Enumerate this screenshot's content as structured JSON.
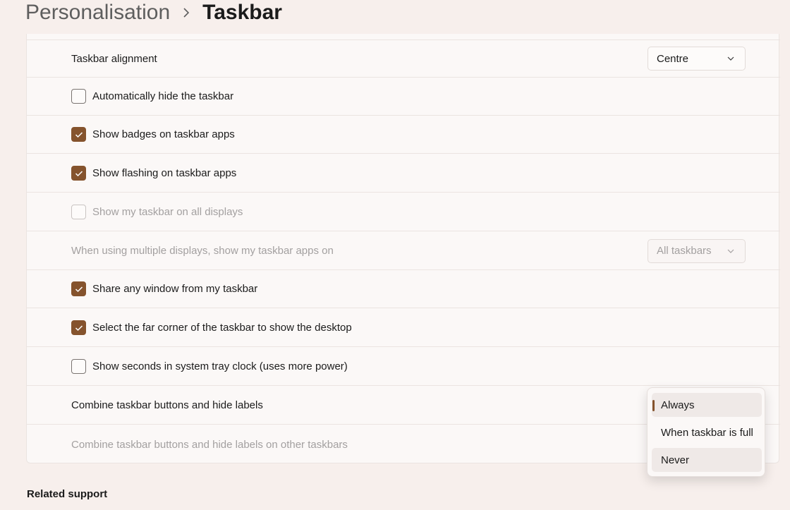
{
  "breadcrumb": {
    "parent": "Personalisation",
    "separator": "›",
    "current": "Taskbar"
  },
  "settings": [
    {
      "label": "Taskbar alignment",
      "control": "dropdown",
      "value": "Centre"
    },
    {
      "label": "Automatically hide the taskbar",
      "control": "checkbox",
      "checked": false
    },
    {
      "label": "Show badges on taskbar apps",
      "control": "checkbox",
      "checked": true
    },
    {
      "label": "Show flashing on taskbar apps",
      "control": "checkbox",
      "checked": true
    },
    {
      "label": "Show my taskbar on all displays",
      "control": "checkbox",
      "checked": false,
      "disabled": true
    },
    {
      "label": "When using multiple displays, show my taskbar apps on",
      "control": "dropdown",
      "value": "All taskbars",
      "disabled": true
    },
    {
      "label": "Share any window from my taskbar",
      "control": "checkbox",
      "checked": true
    },
    {
      "label": "Select the far corner of the taskbar to show the desktop",
      "control": "checkbox",
      "checked": true
    },
    {
      "label": "Show seconds in system tray clock (uses more power)",
      "control": "checkbox",
      "checked": false
    },
    {
      "label": "Combine taskbar buttons and hide labels",
      "control": "dropdown-open"
    },
    {
      "label": "Combine taskbar buttons and hide labels on other taskbars",
      "control": "none",
      "disabled": true
    }
  ],
  "combine_menu": {
    "options": [
      "Always",
      "When taskbar is full",
      "Never"
    ],
    "selected": "Always",
    "hovered": "Never"
  },
  "related_support": "Related support",
  "colors": {
    "accent": "#85532d",
    "background": "#f7efec",
    "panel": "#fbf8f7"
  }
}
